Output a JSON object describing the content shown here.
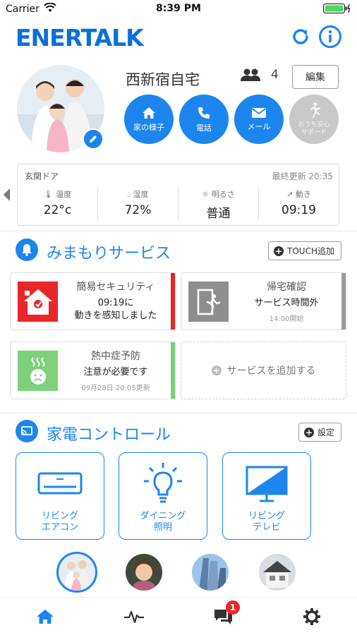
{
  "status_bar": {
    "carrier": "Carrier",
    "time": "8:39 PM"
  },
  "app": {
    "logo": "ENERTALK"
  },
  "home": {
    "name": "西新宿自宅",
    "member_count": "4",
    "edit_label": "編集",
    "actions": [
      {
        "label": "家の様子",
        "icon": "house-icon"
      },
      {
        "label": "電話",
        "icon": "phone-icon"
      },
      {
        "label": "メール",
        "icon": "mail-icon"
      },
      {
        "label": "おうち安心サポート",
        "icon": "running-person-icon",
        "enabled": false
      }
    ]
  },
  "sensor": {
    "location": "玄関ドア",
    "last_updated": "最終更新 20:35",
    "metrics": [
      {
        "label": "温度",
        "value": "22°c",
        "icon": "thermometer-icon"
      },
      {
        "label": "湿度",
        "value": "72%",
        "icon": "droplet-icon"
      },
      {
        "label": "明るさ",
        "value": "普通",
        "icon": "sun-icon"
      },
      {
        "label": "動き",
        "value": "09:19",
        "icon": "motion-icon"
      }
    ]
  },
  "watch_service": {
    "title": "みまもりサービス",
    "add_button": "TOUCH追加",
    "cards": [
      {
        "title": "簡易セキュリティ",
        "line1": "09:19に",
        "line2": "動きを感知しました",
        "accent": "#e8262a"
      },
      {
        "title": "帰宅確認",
        "line1": "サービス時間外",
        "note": "14:00開始",
        "accent": "#9a9a9a"
      },
      {
        "title": "熱中症予防",
        "line1": "注意が必要です",
        "note": "09月28日 20:05更新",
        "accent": "#7ed07a"
      }
    ],
    "add_service": "サービスを追加する"
  },
  "appliances": {
    "title": "家電コントロール",
    "settings_button": "設定",
    "items": [
      {
        "line1": "リビング",
        "line2": "エアコン",
        "icon": "air-conditioner-icon"
      },
      {
        "line1": "ダイニング",
        "line2": "照明",
        "icon": "light-bulb-icon"
      },
      {
        "line1": "リビング",
        "line2": "テレビ",
        "icon": "tv-icon"
      }
    ]
  },
  "tabs": {
    "messages_badge": "1"
  },
  "colors": {
    "accent": "#1c86ee",
    "security": "#e8262a",
    "heat": "#7ed07a",
    "muted": "#c8c8c8"
  }
}
